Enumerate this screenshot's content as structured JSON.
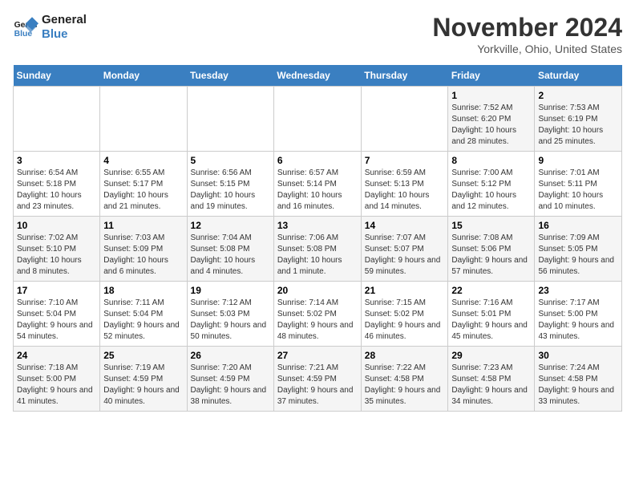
{
  "logo": {
    "line1": "General",
    "line2": "Blue"
  },
  "title": "November 2024",
  "subtitle": "Yorkville, Ohio, United States",
  "days_of_week": [
    "Sunday",
    "Monday",
    "Tuesday",
    "Wednesday",
    "Thursday",
    "Friday",
    "Saturday"
  ],
  "weeks": [
    [
      {
        "day": "",
        "info": ""
      },
      {
        "day": "",
        "info": ""
      },
      {
        "day": "",
        "info": ""
      },
      {
        "day": "",
        "info": ""
      },
      {
        "day": "",
        "info": ""
      },
      {
        "day": "1",
        "info": "Sunrise: 7:52 AM\nSunset: 6:20 PM\nDaylight: 10 hours and 28 minutes."
      },
      {
        "day": "2",
        "info": "Sunrise: 7:53 AM\nSunset: 6:19 PM\nDaylight: 10 hours and 25 minutes."
      }
    ],
    [
      {
        "day": "3",
        "info": "Sunrise: 6:54 AM\nSunset: 5:18 PM\nDaylight: 10 hours and 23 minutes."
      },
      {
        "day": "4",
        "info": "Sunrise: 6:55 AM\nSunset: 5:17 PM\nDaylight: 10 hours and 21 minutes."
      },
      {
        "day": "5",
        "info": "Sunrise: 6:56 AM\nSunset: 5:15 PM\nDaylight: 10 hours and 19 minutes."
      },
      {
        "day": "6",
        "info": "Sunrise: 6:57 AM\nSunset: 5:14 PM\nDaylight: 10 hours and 16 minutes."
      },
      {
        "day": "7",
        "info": "Sunrise: 6:59 AM\nSunset: 5:13 PM\nDaylight: 10 hours and 14 minutes."
      },
      {
        "day": "8",
        "info": "Sunrise: 7:00 AM\nSunset: 5:12 PM\nDaylight: 10 hours and 12 minutes."
      },
      {
        "day": "9",
        "info": "Sunrise: 7:01 AM\nSunset: 5:11 PM\nDaylight: 10 hours and 10 minutes."
      }
    ],
    [
      {
        "day": "10",
        "info": "Sunrise: 7:02 AM\nSunset: 5:10 PM\nDaylight: 10 hours and 8 minutes."
      },
      {
        "day": "11",
        "info": "Sunrise: 7:03 AM\nSunset: 5:09 PM\nDaylight: 10 hours and 6 minutes."
      },
      {
        "day": "12",
        "info": "Sunrise: 7:04 AM\nSunset: 5:08 PM\nDaylight: 10 hours and 4 minutes."
      },
      {
        "day": "13",
        "info": "Sunrise: 7:06 AM\nSunset: 5:08 PM\nDaylight: 10 hours and 1 minute."
      },
      {
        "day": "14",
        "info": "Sunrise: 7:07 AM\nSunset: 5:07 PM\nDaylight: 9 hours and 59 minutes."
      },
      {
        "day": "15",
        "info": "Sunrise: 7:08 AM\nSunset: 5:06 PM\nDaylight: 9 hours and 57 minutes."
      },
      {
        "day": "16",
        "info": "Sunrise: 7:09 AM\nSunset: 5:05 PM\nDaylight: 9 hours and 56 minutes."
      }
    ],
    [
      {
        "day": "17",
        "info": "Sunrise: 7:10 AM\nSunset: 5:04 PM\nDaylight: 9 hours and 54 minutes."
      },
      {
        "day": "18",
        "info": "Sunrise: 7:11 AM\nSunset: 5:04 PM\nDaylight: 9 hours and 52 minutes."
      },
      {
        "day": "19",
        "info": "Sunrise: 7:12 AM\nSunset: 5:03 PM\nDaylight: 9 hours and 50 minutes."
      },
      {
        "day": "20",
        "info": "Sunrise: 7:14 AM\nSunset: 5:02 PM\nDaylight: 9 hours and 48 minutes."
      },
      {
        "day": "21",
        "info": "Sunrise: 7:15 AM\nSunset: 5:02 PM\nDaylight: 9 hours and 46 minutes."
      },
      {
        "day": "22",
        "info": "Sunrise: 7:16 AM\nSunset: 5:01 PM\nDaylight: 9 hours and 45 minutes."
      },
      {
        "day": "23",
        "info": "Sunrise: 7:17 AM\nSunset: 5:00 PM\nDaylight: 9 hours and 43 minutes."
      }
    ],
    [
      {
        "day": "24",
        "info": "Sunrise: 7:18 AM\nSunset: 5:00 PM\nDaylight: 9 hours and 41 minutes."
      },
      {
        "day": "25",
        "info": "Sunrise: 7:19 AM\nSunset: 4:59 PM\nDaylight: 9 hours and 40 minutes."
      },
      {
        "day": "26",
        "info": "Sunrise: 7:20 AM\nSunset: 4:59 PM\nDaylight: 9 hours and 38 minutes."
      },
      {
        "day": "27",
        "info": "Sunrise: 7:21 AM\nSunset: 4:59 PM\nDaylight: 9 hours and 37 minutes."
      },
      {
        "day": "28",
        "info": "Sunrise: 7:22 AM\nSunset: 4:58 PM\nDaylight: 9 hours and 35 minutes."
      },
      {
        "day": "29",
        "info": "Sunrise: 7:23 AM\nSunset: 4:58 PM\nDaylight: 9 hours and 34 minutes."
      },
      {
        "day": "30",
        "info": "Sunrise: 7:24 AM\nSunset: 4:58 PM\nDaylight: 9 hours and 33 minutes."
      }
    ]
  ]
}
